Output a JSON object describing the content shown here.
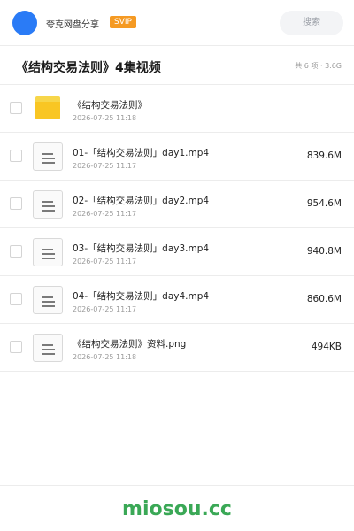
{
  "header": {
    "share_name": "夸克网盘分享",
    "badge": "SVIP",
    "search_placeholder": "搜索"
  },
  "folder": {
    "title": "《结构交易法则》4集视频",
    "summary": "共 6 项 · 3.6G"
  },
  "files": [
    {
      "type": "folder",
      "icon": "folder-icon",
      "name": "《结构交易法则》",
      "date": "2026-07-25 11:18",
      "size": ""
    },
    {
      "type": "file",
      "icon": "file-icon",
      "name": "01-「结构交易法则」day1.mp4",
      "date": "2026-07-25 11:17",
      "size": "839.6M"
    },
    {
      "type": "file",
      "icon": "file-icon",
      "name": "02-「结构交易法则」day2.mp4",
      "date": "2026-07-25 11:17",
      "size": "954.6M"
    },
    {
      "type": "file",
      "icon": "file-icon",
      "name": "03-「结构交易法则」day3.mp4",
      "date": "2026-07-25 11:17",
      "size": "940.8M"
    },
    {
      "type": "file",
      "icon": "file-icon",
      "name": "04-「结构交易法则」day4.mp4",
      "date": "2026-07-25 11:17",
      "size": "860.6M"
    },
    {
      "type": "file",
      "icon": "file-icon",
      "name": "《结构交易法则》资料.png",
      "date": "2026-07-25 11:18",
      "size": "494KB"
    }
  ],
  "watermark": "miosou.cc",
  "colors": {
    "avatar": "#2a7bf6",
    "svip_badge": "#f59a23",
    "folder": "#f9c623",
    "watermark": "#3aa856"
  }
}
